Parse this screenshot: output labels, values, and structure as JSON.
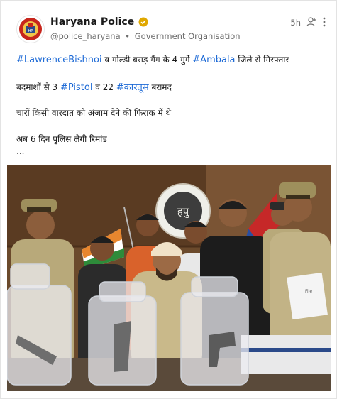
{
  "post": {
    "author": {
      "name": "Haryana Police",
      "handle": "@police_haryana",
      "separator": "•",
      "account_type": "Government Organisation",
      "verified": true,
      "avatar_icon": "haryana-police-emblem-icon"
    },
    "time": "5h",
    "icons": {
      "follow": "add-person-icon",
      "more": "more-options-icon"
    },
    "lines": {
      "line1": {
        "tag1": "#LawrenceBishnoi",
        "text1": " व गोल्डी बराड़ गैंग के 4 गुर्गे ",
        "tag2": "#Ambala",
        "text2": " जिले से गिरफ्तार"
      },
      "line2": {
        "text1": "बदमाशों से 3 ",
        "tag1": "#Pistol",
        "text2": " व 22 ",
        "tag2": "#कारतूस",
        "text3": " बरामद"
      },
      "line3": "चारों किसी वारदात को अंजाम देने की फिराक में थे",
      "line4": "अब 6 दिन पुलिस लेगी रिमांड",
      "ellipsis": "..."
    },
    "photo": {
      "board_text": "हपु",
      "folder_text": "File"
    },
    "colors": {
      "hashtag": "#1f6bd6",
      "verified_badge": "#e0a800",
      "wall": "#6b4a2c"
    }
  }
}
